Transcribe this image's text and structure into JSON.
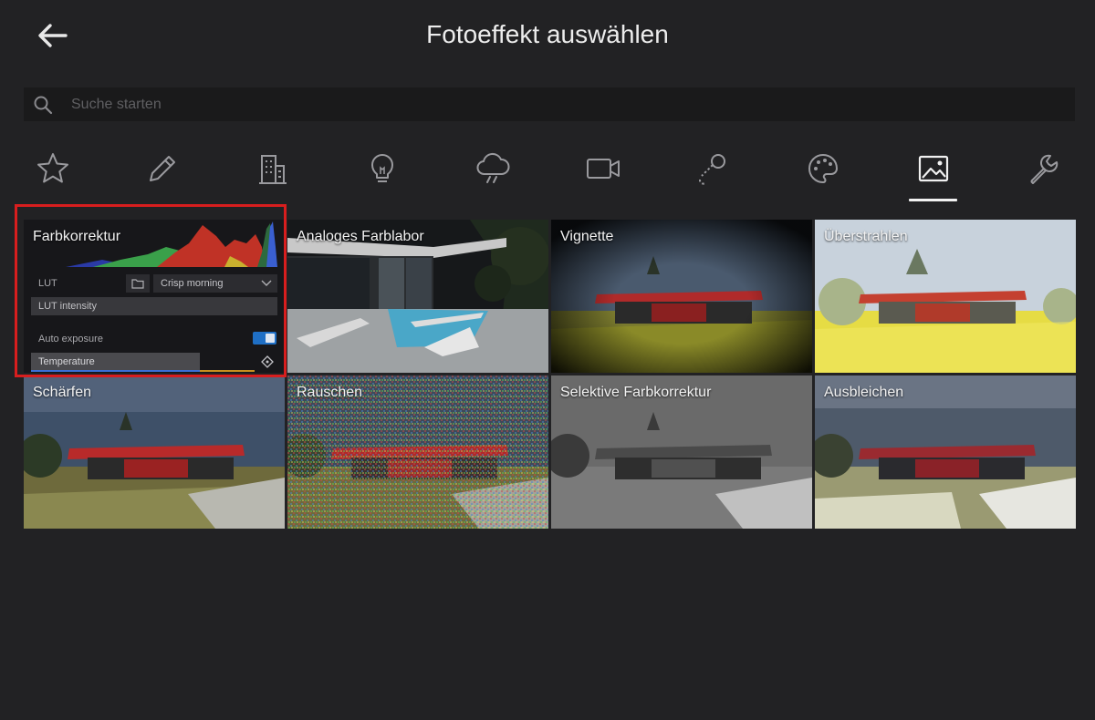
{
  "header": {
    "title": "Fotoeffekt auswählen"
  },
  "search": {
    "placeholder": "Suche starten",
    "value": ""
  },
  "categories": [
    {
      "name": "favorites",
      "icon": "star-icon"
    },
    {
      "name": "edit",
      "icon": "pencil-icon"
    },
    {
      "name": "buildings",
      "icon": "building-icon"
    },
    {
      "name": "lighting",
      "icon": "lightbulb-icon"
    },
    {
      "name": "weather",
      "icon": "cloud-rain-icon"
    },
    {
      "name": "video",
      "icon": "video-camera-icon"
    },
    {
      "name": "selection",
      "icon": "lasso-icon"
    },
    {
      "name": "style",
      "icon": "palette-icon"
    },
    {
      "name": "photo",
      "icon": "image-icon",
      "active": true
    },
    {
      "name": "tools",
      "icon": "wrench-icon"
    }
  ],
  "effects": [
    {
      "label": "Farbkorrektur",
      "selected": true
    },
    {
      "label": "Analoges Farblabor"
    },
    {
      "label": "Vignette"
    },
    {
      "label": "Überstrahlen"
    },
    {
      "label": "Schärfen"
    },
    {
      "label": "Rauschen"
    },
    {
      "label": "Selektive Farbkorrektur"
    },
    {
      "label": "Ausbleichen"
    }
  ],
  "farbkorrektur_panel": {
    "lut_label": "LUT",
    "lut_value": "Crisp morning",
    "lut_intensity_label": "LUT intensity",
    "auto_exposure_label": "Auto exposure",
    "auto_exposure_on": true,
    "temperature_label": "Temperature"
  },
  "colors": {
    "background": "#222224",
    "highlight": "#d81e1e",
    "toggle": "#1f6fc5"
  }
}
